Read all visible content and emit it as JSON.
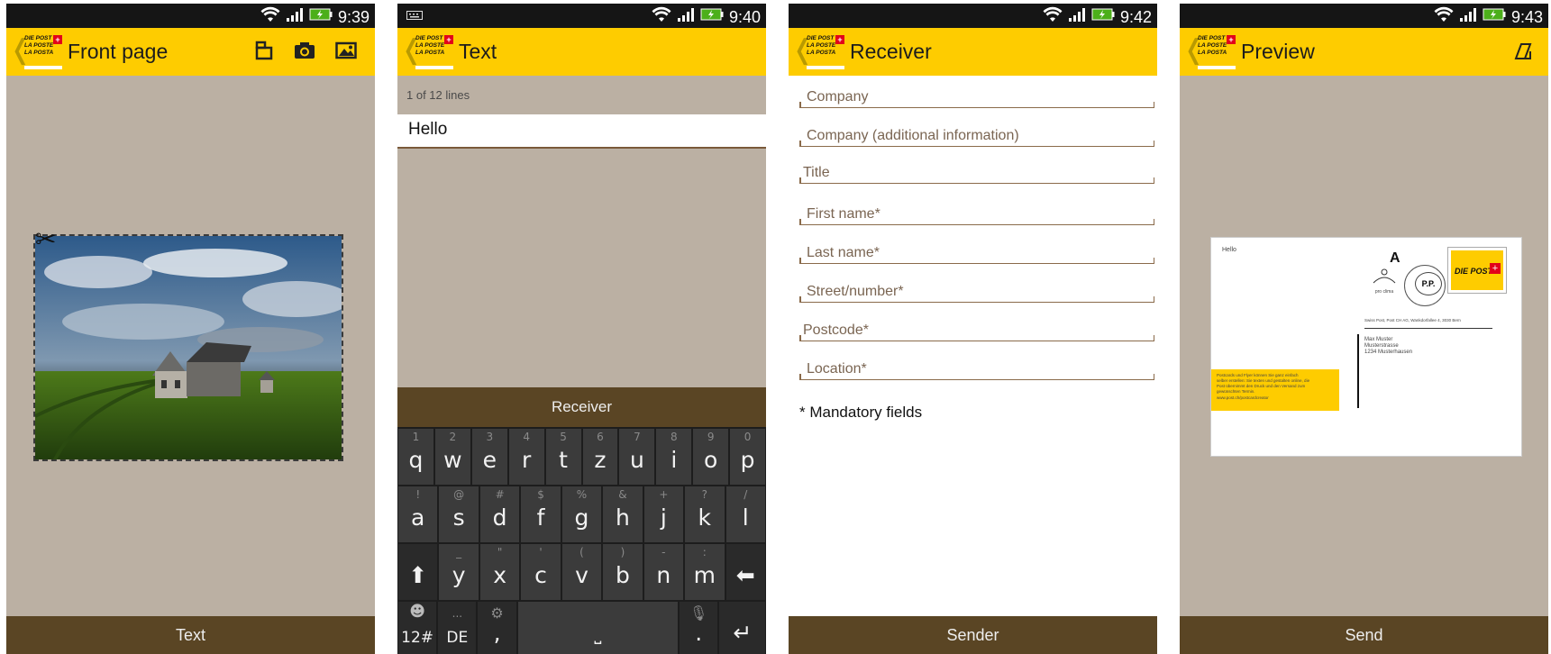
{
  "status": {
    "times": [
      "9:39",
      "9:40",
      "9:42",
      "9:43"
    ],
    "keyboard_icon": "keyboard-icon"
  },
  "logo": {
    "lines": [
      "DIE POST",
      "LA POSTE",
      "LA POSTA"
    ],
    "cross": "+"
  },
  "screens": {
    "front": {
      "title": "Front page",
      "icons": [
        "layout-icon",
        "camera-icon",
        "image-icon"
      ],
      "bottom": "Text"
    },
    "text": {
      "title": "Text",
      "line_count": "1 of 12 lines",
      "value": "Hello",
      "receiver_button": "Receiver",
      "keyboard": {
        "row1": [
          {
            "k": "q",
            "a": "1"
          },
          {
            "k": "w",
            "a": "2"
          },
          {
            "k": "e",
            "a": "3"
          },
          {
            "k": "r",
            "a": "4"
          },
          {
            "k": "t",
            "a": "5"
          },
          {
            "k": "z",
            "a": "6"
          },
          {
            "k": "u",
            "a": "7"
          },
          {
            "k": "i",
            "a": "8"
          },
          {
            "k": "o",
            "a": "9"
          },
          {
            "k": "p",
            "a": "0"
          }
        ],
        "row2": [
          {
            "k": "a",
            "a": "!"
          },
          {
            "k": "s",
            "a": "@"
          },
          {
            "k": "d",
            "a": "#"
          },
          {
            "k": "f",
            "a": "$"
          },
          {
            "k": "g",
            "a": "%"
          },
          {
            "k": "h",
            "a": "&"
          },
          {
            "k": "j",
            "a": "+"
          },
          {
            "k": "k",
            "a": "?"
          },
          {
            "k": "l",
            "a": "/"
          }
        ],
        "row3": [
          {
            "k": "y",
            "a": "_"
          },
          {
            "k": "x",
            "a": "\""
          },
          {
            "k": "c",
            "a": "'"
          },
          {
            "k": "v",
            "a": "("
          },
          {
            "k": "b",
            "a": ")"
          },
          {
            "k": "n",
            "a": "-"
          },
          {
            "k": "m",
            "a": ":"
          }
        ],
        "shift": "⬆",
        "backspace": "⬅",
        "symbols": "12#",
        "language": "DE",
        "language_alt": "...",
        "comma": ",",
        "period": ".",
        "enter": "↵",
        "emoji": "☻",
        "settings": "⚙"
      }
    },
    "receiver": {
      "title": "Receiver",
      "fields": [
        "Company",
        "Company (additional information)",
        "Title",
        "First name*",
        "Last name*",
        "Street/number*",
        "Postcode*",
        "Location*"
      ],
      "mandatory_note": "* Mandatory fields",
      "bottom": "Sender"
    },
    "preview": {
      "title": "Preview",
      "bottom": "Send",
      "card": {
        "message": "Hello",
        "class_letter": "A",
        "pp": "P.P.",
        "brand": "DIE POST",
        "sender_line": "Swiss Post, Post CH AG, Wankdorfallee 4, 3030 Bern",
        "address": [
          "Max Muster",
          "Musterstrasse",
          "1234 Musterhausen"
        ],
        "promo": [
          "Postcards und Flyer können Sie ganz einfach",
          "selber erstellen: Sie texten und gestalten online, die",
          "Post übernimmt den Druck und den Versand zum",
          "gewünschten Termin.",
          "www.post.ch/postcardcreator"
        ],
        "pro_clima": "pro clima"
      }
    }
  }
}
